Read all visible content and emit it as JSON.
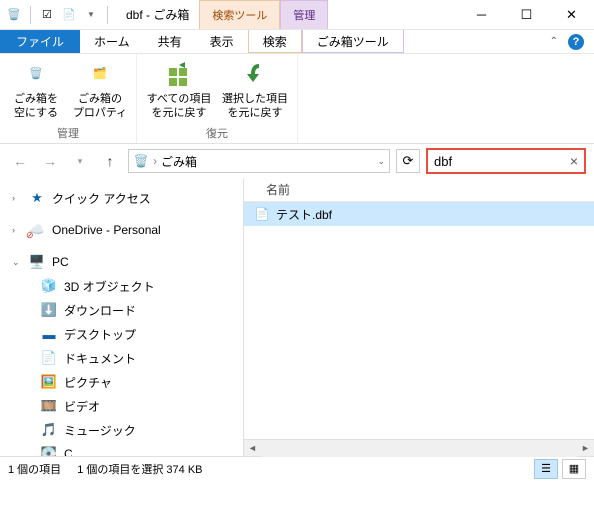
{
  "window": {
    "title": "dbf - ごみ箱",
    "contextual_tabs": {
      "search": "検索ツール",
      "manage": "管理"
    }
  },
  "menu": {
    "file": "ファイル",
    "home": "ホーム",
    "share": "共有",
    "view": "表示",
    "search": "検索",
    "trash_tools": "ごみ箱ツール"
  },
  "ribbon": {
    "empty": "ごみ箱を\n空にする",
    "props": "ごみ箱の\nプロパティ",
    "restore_all": "すべての項目\nを元に戻す",
    "restore_sel": "選択した項目\nを元に戻す",
    "group_manage": "管理",
    "group_restore": "復元"
  },
  "address": {
    "location": "ごみ箱"
  },
  "search": {
    "value": "dbf"
  },
  "sidebar": {
    "quick_access": "クイック アクセス",
    "onedrive": "OneDrive - Personal",
    "pc": "PC",
    "items": [
      "3D オブジェクト",
      "ダウンロード",
      "デスクトップ",
      "ドキュメント",
      "ピクチャ",
      "ビデオ",
      "ミュージック",
      "C"
    ]
  },
  "columns": {
    "name": "名前"
  },
  "files": [
    {
      "name": "テスト.dbf"
    }
  ],
  "status": {
    "count": "1 個の項目",
    "selected": "1 個の項目を選択 374 KB"
  }
}
